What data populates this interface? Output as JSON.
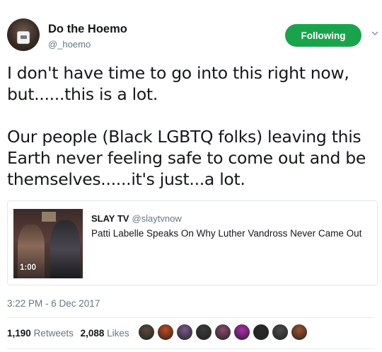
{
  "author": {
    "display_name": "Do the Hoemo",
    "handle": "@_hoemo"
  },
  "follow_button": {
    "label": "Following",
    "color": "#19a44c"
  },
  "tweet": {
    "paragraph1_line1": "I don't have time to go into this right now,",
    "paragraph1_line2": "but......this is a lot.",
    "paragraph2_line1": "Our people (Black LGBTQ folks) leaving this",
    "paragraph2_line2": "Earth never feeling safe to come out and be",
    "paragraph2_line3": "themselves......it's just...a lot."
  },
  "card": {
    "author_name": "SLAY TV",
    "author_handle": "@slaytvnow",
    "title": "Patti Labelle Speaks On Why Luther Vandross Never Came Out",
    "duration": "1:00"
  },
  "timestamp": "3:22 PM - 6 Dec 2017",
  "stats": {
    "retweets_count": "1,190",
    "retweets_label": "Retweets",
    "likes_count": "2,088",
    "likes_label": "Likes"
  },
  "likers": [
    {
      "color": "#5a4a3a"
    },
    {
      "color": "#c24a1e"
    },
    {
      "color": "#7a5a8a"
    },
    {
      "color": "#3a3a3a"
    },
    {
      "color": "#8a4a6a"
    },
    {
      "color": "#b02ab0"
    },
    {
      "color": "#2a2a2a"
    },
    {
      "color": "#4a4a4a"
    },
    {
      "color": "#a0522d"
    }
  ],
  "colors": {
    "text": "#14171a",
    "secondary": "#657786",
    "border": "#e1e8ed"
  }
}
